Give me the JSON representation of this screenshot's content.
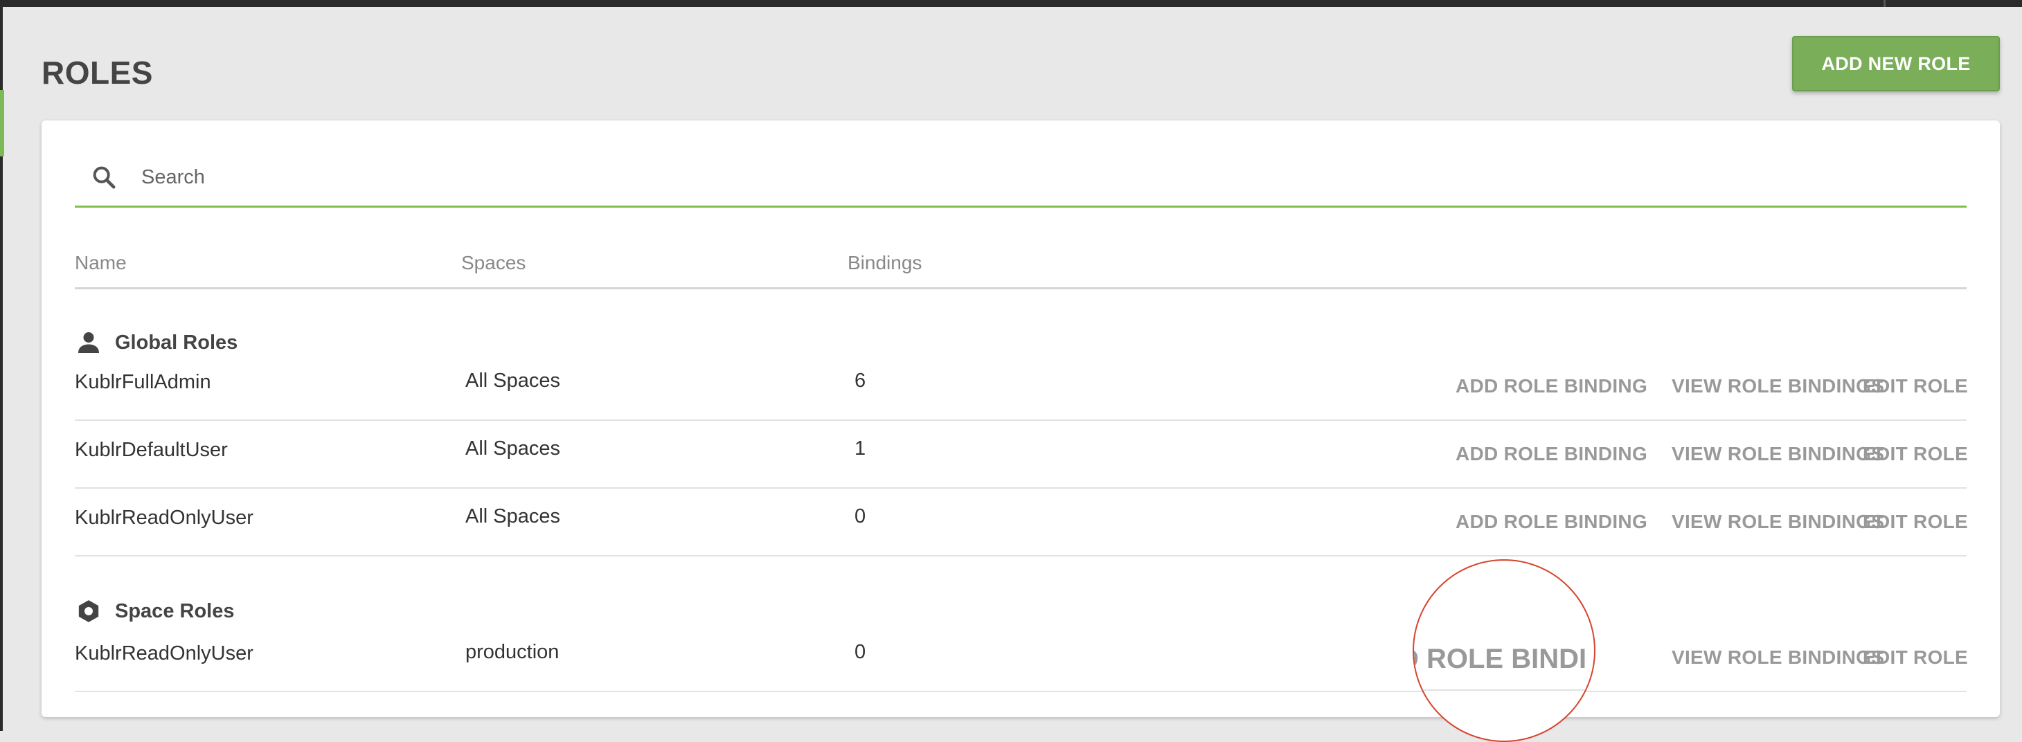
{
  "page": {
    "title": "ROLES",
    "add_new_role_label": "ADD NEW ROLE"
  },
  "search": {
    "placeholder": "Search",
    "value": "",
    "icon": "search-icon"
  },
  "table": {
    "columns": {
      "name": "Name",
      "spaces": "Spaces",
      "bindings": "Bindings"
    },
    "actions": {
      "add_binding": "ADD ROLE BINDING",
      "view_bindings": "VIEW ROLE BINDINGS",
      "edit": "EDIT ROLE"
    },
    "global_section": {
      "label": "Global Roles",
      "icon": "person-icon",
      "rows": [
        {
          "name": "KublrFullAdmin",
          "spaces": "All Spaces",
          "bindings": "6"
        },
        {
          "name": "KublrDefaultUser",
          "spaces": "All Spaces",
          "bindings": "1"
        },
        {
          "name": "KublrReadOnlyUser",
          "spaces": "All Spaces",
          "bindings": "0"
        }
      ]
    },
    "space_section": {
      "label": "Space Roles",
      "icon": "hexagon-icon",
      "rows": [
        {
          "name": "KublrReadOnlyUser",
          "spaces": "production",
          "bindings": "0"
        }
      ]
    }
  },
  "cursor_highlight": {
    "zoomed_text": "D ROLE BINDI"
  },
  "colors": {
    "accent_green": "#7aae59",
    "search_underline": "#7cc049",
    "action_gray": "#999999",
    "cursor_ring": "#d6442e"
  }
}
